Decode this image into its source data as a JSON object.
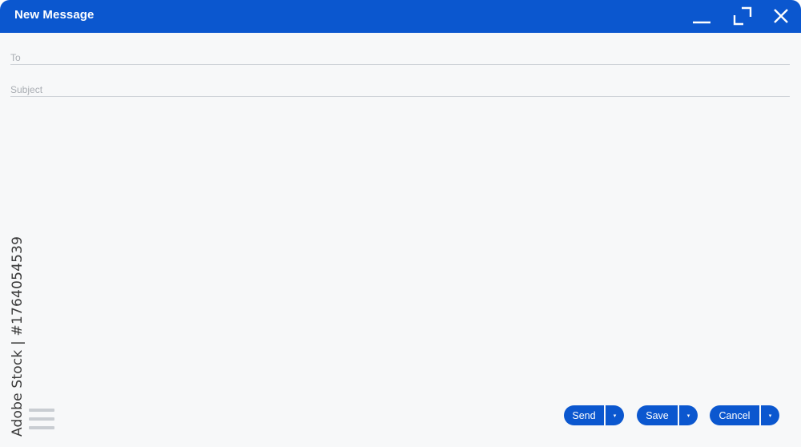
{
  "window": {
    "title": "New Message"
  },
  "fields": {
    "to": {
      "placeholder": "To",
      "value": ""
    },
    "subject": {
      "placeholder": "Subject",
      "value": ""
    }
  },
  "buttons": {
    "send": {
      "label": "Send",
      "arrow": "▾"
    },
    "save": {
      "label": "Save",
      "arrow": "▾"
    },
    "cancel": {
      "label": "Cancel",
      "arrow": "▾"
    }
  },
  "icons": {
    "minimize": "minimize-icon",
    "maximize": "maximize-icon",
    "close": "close-icon",
    "menu": "menu-icon"
  },
  "watermark": {
    "side_text": "Adobe Stock | #1764054539"
  },
  "colors": {
    "accent": "#0b57cf",
    "background": "#f7f8f9",
    "field_border": "#cfd3d8",
    "placeholder": "#a9adb3"
  }
}
